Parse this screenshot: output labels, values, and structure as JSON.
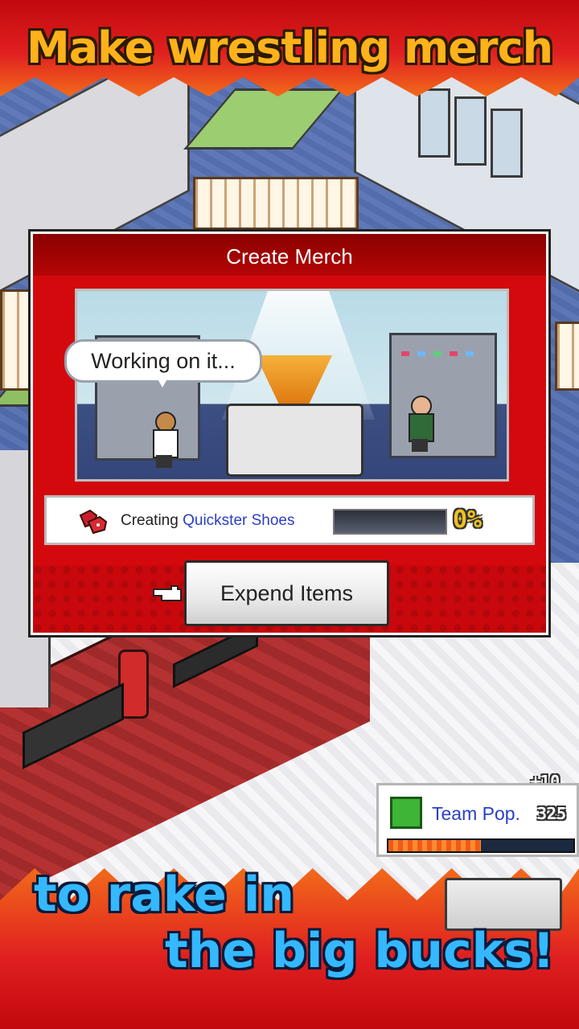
{
  "banner": {
    "top_text": "Make wrestling merch",
    "bottom_line1": "to rake in",
    "bottom_line2": "the big bucks!"
  },
  "dialog": {
    "title": "Create Merch",
    "speech": "Working on it...",
    "progress": {
      "prefix": "Creating",
      "item_name": "Quickster Shoes",
      "percent_text": "0%",
      "percent_value": 0
    },
    "button_label": "Expend Items"
  },
  "team_pop": {
    "label": "Team Pop.",
    "value": "325",
    "bonus": "+10",
    "bar_fraction": 0.5
  },
  "colors": {
    "dialog_red": "#d4090d",
    "banner_orange_text": "#ffb21a",
    "banner_blue_text": "#34b8ff",
    "item_link_blue": "#2a3fc7"
  },
  "icons": {
    "merch": "shoes-icon",
    "pointer": "pointing-hand-icon",
    "team_pop": "muscle-icon"
  }
}
